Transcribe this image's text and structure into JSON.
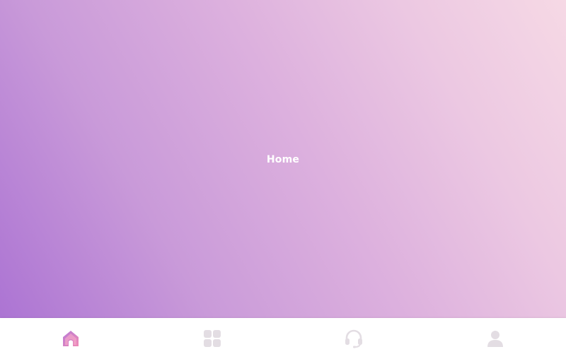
{
  "main": {
    "title": "Home"
  },
  "tabbar": {
    "items": [
      {
        "id": "home",
        "icon": "home-icon",
        "active": true
      },
      {
        "id": "apps",
        "icon": "grid-icon",
        "active": false
      },
      {
        "id": "support",
        "icon": "headset-icon",
        "active": false
      },
      {
        "id": "profile",
        "icon": "user-icon",
        "active": false
      }
    ]
  },
  "colors": {
    "gradient_start": "#ac74d3",
    "gradient_end": "#f6d9e5",
    "active_icon": "#e87fb5",
    "active_icon_alt": "#b87ad6",
    "inactive_icon": "#e3dde3",
    "tabbar_background": "#ffffff"
  }
}
